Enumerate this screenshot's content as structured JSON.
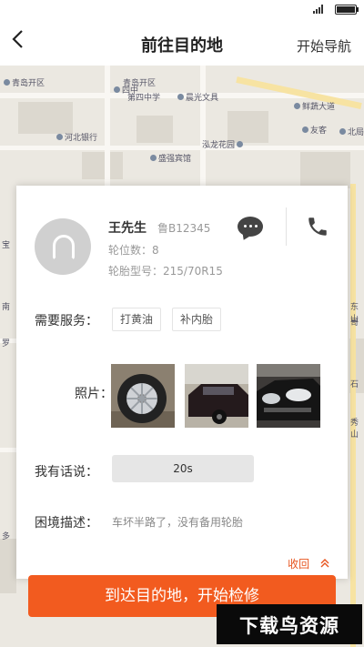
{
  "nav": {
    "back_glyph": "<",
    "title": "前往目的地",
    "action": "开始导航"
  },
  "map": {
    "pois": [
      "青岛开区",
      "四中",
      "第四中学",
      "晨光文具",
      "鲜蔬大道",
      "友客",
      "北局",
      "河北银行",
      "泓龙花园",
      "盛强宾馆",
      "宝",
      "南",
      "东山",
      "哥",
      "石",
      "秀山",
      "多",
      "罗"
    ]
  },
  "driver": {
    "name": "王先生",
    "plate": "鲁B12345",
    "tire_count": "轮位数：8",
    "tire_model": "轮胎型号：215/70R15"
  },
  "service": {
    "label": "需要服务：",
    "tags": [
      "打黄油",
      "补内胎"
    ]
  },
  "photos": {
    "label": "照片："
  },
  "voice": {
    "label": "我有话说：",
    "duration": "20s"
  },
  "description": {
    "label": "困境描述：",
    "text": "车坏半路了，没有备用轮胎"
  },
  "collapse": {
    "label": "收回",
    "icon": "double-chevron-up-icon"
  },
  "arrive_button": "到达目的地，开始检修",
  "watermark": "下载鸟资源",
  "icons": {
    "message": "chat-bubble-icon",
    "phone": "phone-icon",
    "back": "back-arrow-icon"
  },
  "colors": {
    "accent": "#f25b1f",
    "collapse": "#e7541e",
    "map_bg": "#ebe8e1"
  }
}
